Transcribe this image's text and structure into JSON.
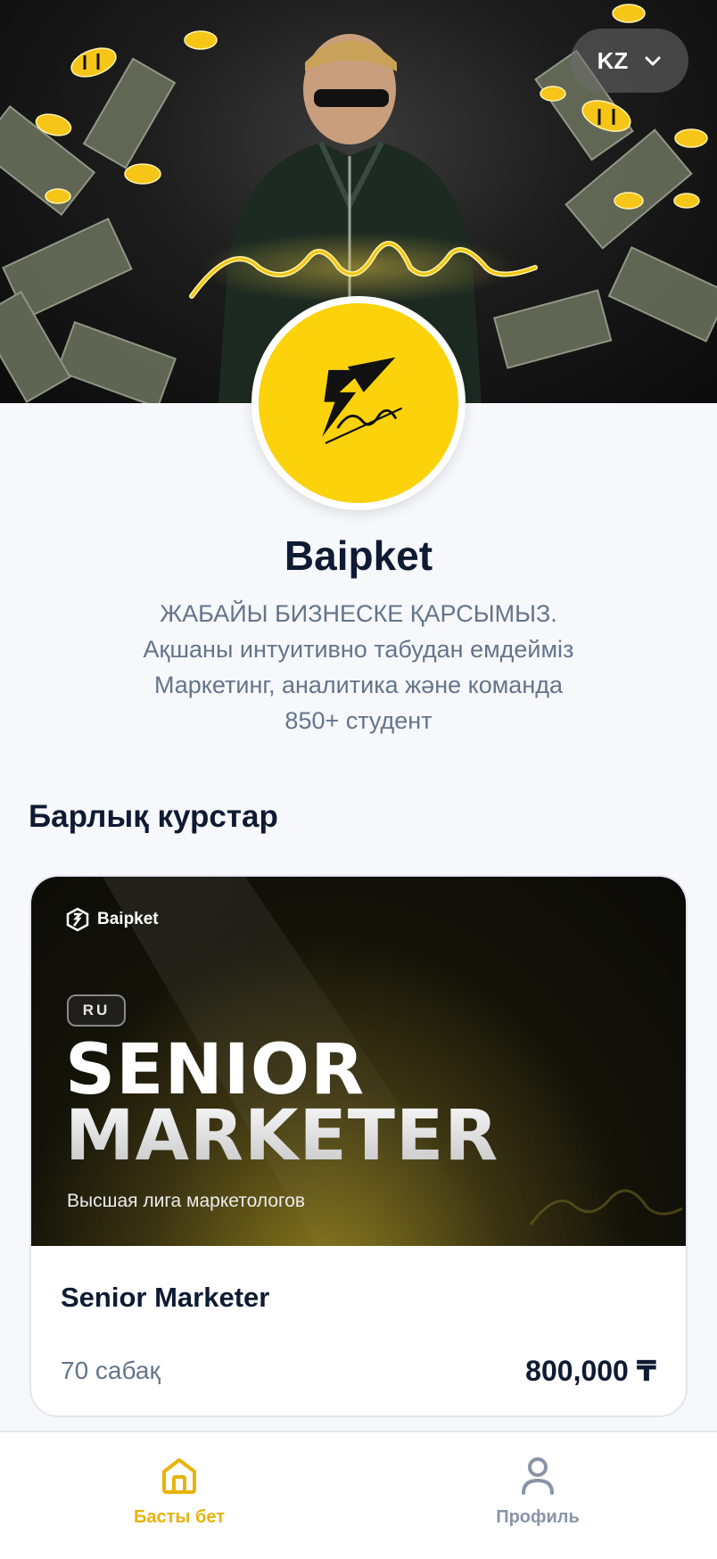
{
  "header": {
    "language": "KZ",
    "banner_signature": "baipket"
  },
  "avatar": {
    "logo_text": "baipket"
  },
  "profile": {
    "name": "Baipket",
    "bio": [
      "ЖАБАЙЫ БИЗНЕСКЕ ҚАРСЫМЫЗ.",
      "Ақшаны интуитивно табудан емдейміз",
      "Маркетинг, аналитика және команда",
      "850+ студент"
    ]
  },
  "courses_section": {
    "title": "Барлық курстар"
  },
  "courses": [
    {
      "cover": {
        "brand": "Baipket",
        "language": "RU",
        "title": "SENIOR\nMARKETER",
        "subtitle": "Высшая лига маркетологов"
      },
      "name": "Senior Marketer",
      "lessons": "70 сабақ",
      "price": "800,000 ₸"
    }
  ],
  "bottom_nav": {
    "home_label": "Басты бет",
    "profile_label": "Профиль"
  },
  "colors": {
    "accent": "#e8b30a",
    "brand_yellow": "#fcd20b",
    "text_primary": "#0f1a33",
    "text_secondary": "#64748b",
    "background": "#f7f8fb"
  },
  "icons": {
    "language_dropdown": "chevron-down-icon",
    "home": "home-icon",
    "profile": "user-icon"
  }
}
